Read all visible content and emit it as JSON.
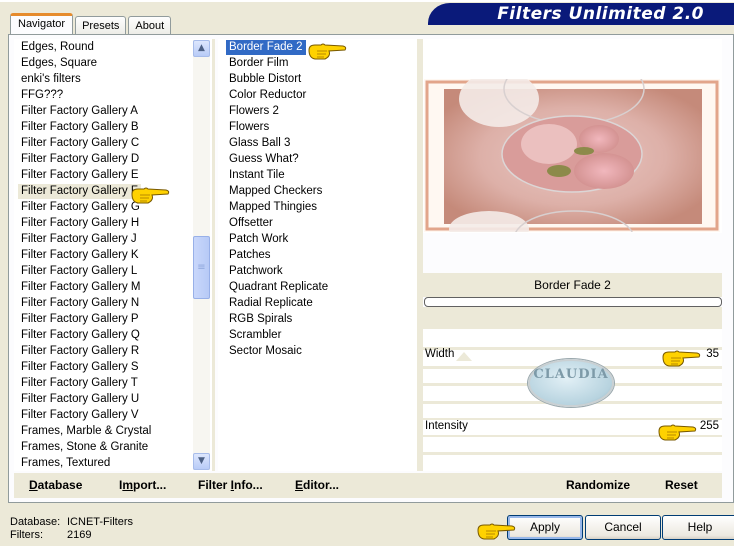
{
  "app": {
    "title": "Filters Unlimited 2.0"
  },
  "tabs": [
    {
      "label": "Navigator",
      "active": true
    },
    {
      "label": "Presets",
      "active": false
    },
    {
      "label": "About",
      "active": false
    }
  ],
  "categories": {
    "items": [
      "Edges, Round",
      "Edges, Square",
      "enki's filters",
      "FFG???",
      "Filter Factory Gallery A",
      "Filter Factory Gallery B",
      "Filter Factory Gallery C",
      "Filter Factory Gallery D",
      "Filter Factory Gallery E",
      "Filter Factory Gallery F",
      "Filter Factory Gallery G",
      "Filter Factory Gallery H",
      "Filter Factory Gallery J",
      "Filter Factory Gallery K",
      "Filter Factory Gallery L",
      "Filter Factory Gallery M",
      "Filter Factory Gallery N",
      "Filter Factory Gallery P",
      "Filter Factory Gallery Q",
      "Filter Factory Gallery R",
      "Filter Factory Gallery S",
      "Filter Factory Gallery T",
      "Filter Factory Gallery U",
      "Filter Factory Gallery V",
      "Frames, Marble & Crystal",
      "Frames, Stone & Granite",
      "Frames, Textured"
    ],
    "highlighted": "Filter Factory Gallery F",
    "scroll_up_icon": "▲",
    "scroll_down_icon": "▼",
    "scroll_grip_icon": "≡"
  },
  "filters": {
    "items": [
      "Border Fade 2",
      "Border Film",
      "Bubble Distort",
      "Color Reductor",
      "Flowers 2",
      "Flowers",
      "Glass Ball 3",
      "Guess What?",
      "Instant Tile",
      "Mapped Checkers",
      "Mapped Thingies",
      "Offsetter",
      "Patch Work",
      "Patches",
      "Patchwork",
      "Quadrant Replicate",
      "Radial Replicate",
      "RGB Spirals",
      "Scrambler",
      "Sector Mosaic"
    ],
    "selected": "Border Fade 2"
  },
  "preview": {
    "filter_name": "Border Fade 2",
    "progress": 0
  },
  "parameters": [
    {
      "label": "Width",
      "value": "35"
    },
    {
      "label": "Intensity",
      "value": "255"
    }
  ],
  "watermark": {
    "text": "CLAUDIA"
  },
  "toolbar": {
    "database": {
      "label": "Database",
      "accel": "D"
    },
    "import": {
      "label": "Import...",
      "accel": "m"
    },
    "filter_info": {
      "label": "Filter Info...",
      "accel": "I"
    },
    "editor": {
      "label": "Editor...",
      "accel": "E"
    },
    "randomize": "Randomize",
    "reset": "Reset"
  },
  "status": {
    "database_label": "Database:",
    "database_value": "ICNET-Filters",
    "filters_label": "Filters:",
    "filters_value": "2169"
  },
  "buttons": {
    "apply": "Apply",
    "cancel": "Cancel",
    "help": "Help"
  },
  "colors": {
    "selection": "#316ac5",
    "banner": "#0a1a7a",
    "tab_accent": "#e68b2c",
    "pointer_hand": "#ffd200"
  }
}
